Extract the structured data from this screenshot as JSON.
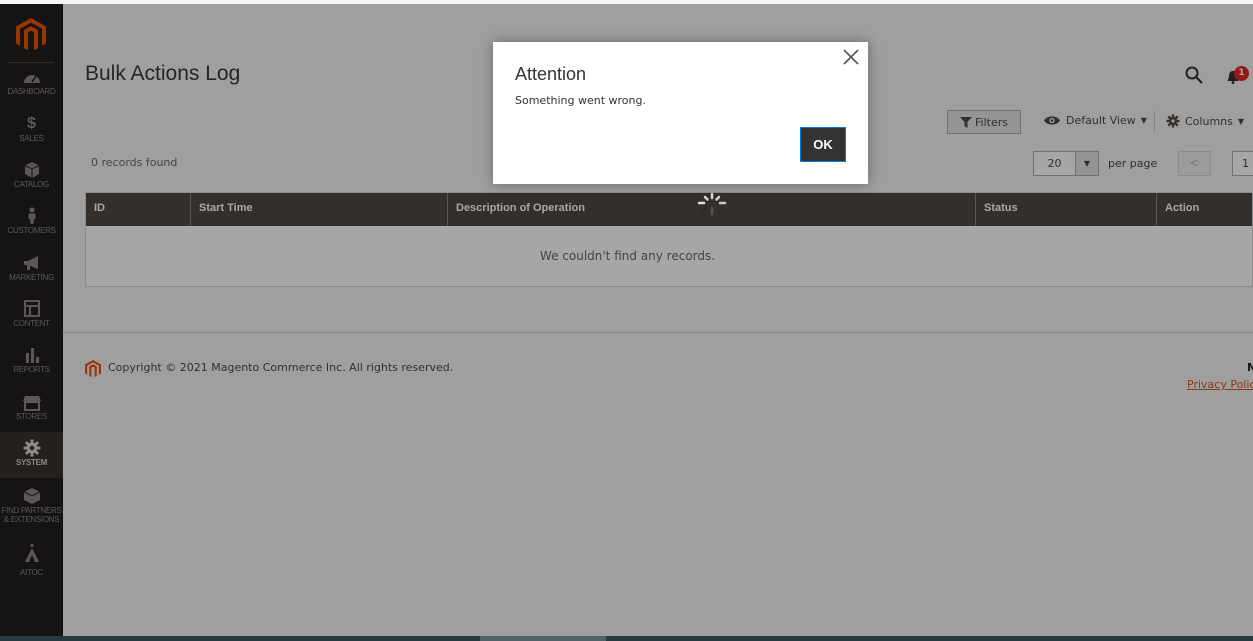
{
  "sidebar": {
    "items": [
      {
        "label": "Dashboard",
        "icon": "dashboard-icon",
        "active": false
      },
      {
        "label": "Sales",
        "icon": "dollar-icon",
        "active": false
      },
      {
        "label": "Catalog",
        "icon": "box-icon",
        "active": false
      },
      {
        "label": "Customers",
        "icon": "person-icon",
        "active": false
      },
      {
        "label": "Marketing",
        "icon": "megaphone-icon",
        "active": false
      },
      {
        "label": "Content",
        "icon": "layout-icon",
        "active": false
      },
      {
        "label": "Reports",
        "icon": "bar-chart-icon",
        "active": false
      },
      {
        "label": "Stores",
        "icon": "storefront-icon",
        "active": false
      },
      {
        "label": "System",
        "icon": "gear-icon",
        "active": true
      },
      {
        "label": "Find Partners",
        "label2": "& Extensions",
        "icon": "partners-box-icon",
        "active": false
      },
      {
        "label": "Aitoc",
        "icon": "aitoc-logo-icon",
        "active": false
      }
    ]
  },
  "header": {
    "title": "Bulk Actions Log",
    "notifications_count": "1"
  },
  "toolbar": {
    "filters_label": "Filters",
    "view_label": "Default View",
    "columns_label": "Columns"
  },
  "grid": {
    "records_found": "0 records found",
    "per_page_value": "20",
    "per_page_label": "per page",
    "prev_label": "<",
    "current_page": "1",
    "columns": [
      "ID",
      "Start Time",
      "Description of Operation",
      "Status",
      "Action"
    ],
    "empty_message": "We couldn't find any records."
  },
  "footer": {
    "copyright": "Copyright © 2021 Magento Commerce Inc. All rights reserved.",
    "version_fragment": "M",
    "privacy_link": "Privacy Policy"
  },
  "modal": {
    "title": "Attention",
    "message": "Something went wrong.",
    "ok_label": "OK"
  },
  "colors": {
    "brand_orange": "#eb5202",
    "sidebar_bg": "#211f1d",
    "grid_header_bg": "#514943",
    "badge_red": "#e22626",
    "link": "#eb5202"
  }
}
